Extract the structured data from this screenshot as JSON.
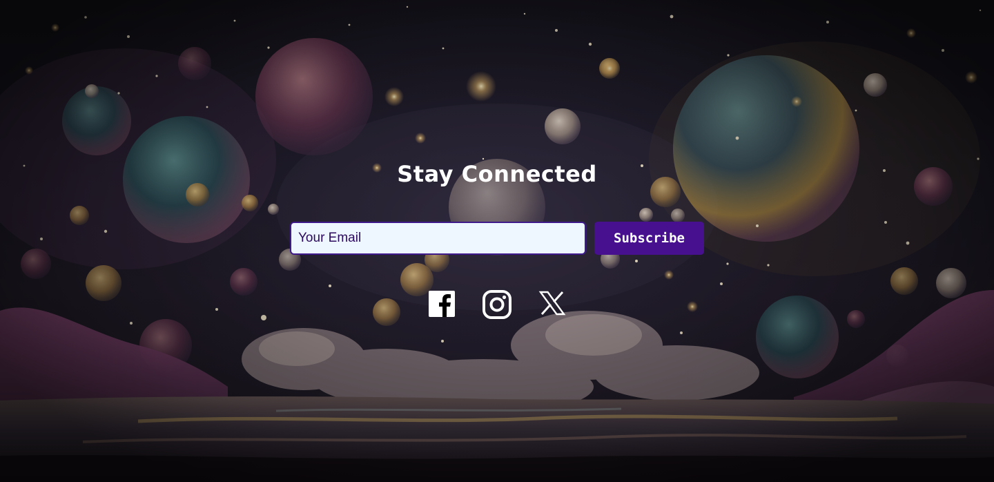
{
  "newsletter": {
    "title": "Stay Connected",
    "email_placeholder": "Your Email",
    "email_value": "",
    "subscribe_label": "Subscribe"
  },
  "socials": [
    {
      "name": "Facebook",
      "icon": "facebook-icon"
    },
    {
      "name": "Instagram",
      "icon": "instagram-icon"
    },
    {
      "name": "X",
      "icon": "x-icon"
    }
  ],
  "colors": {
    "button_bg": "#46108f",
    "input_bg": "#eef6ff",
    "input_border": "#3e1a8a",
    "input_text": "#2b0a5e",
    "title": "#ffffff"
  }
}
